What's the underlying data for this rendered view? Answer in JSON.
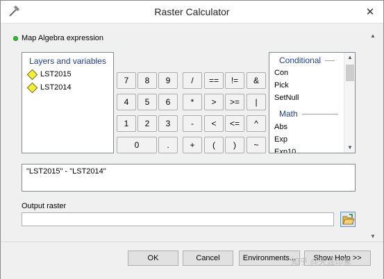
{
  "window": {
    "title": "Raster Calculator",
    "close_glyph": "✕"
  },
  "expression_section": {
    "heading": "Map Algebra expression"
  },
  "layers": {
    "header": "Layers and variables",
    "items": [
      "LST2015",
      "LST2014"
    ]
  },
  "keypad": {
    "rows": [
      [
        "7",
        "8",
        "9",
        "/",
        "==",
        "!=",
        "&"
      ],
      [
        "4",
        "5",
        "6",
        "*",
        ">",
        ">=",
        "|"
      ],
      [
        "1",
        "2",
        "3",
        "-",
        "<",
        "<=",
        "^"
      ],
      [
        "0",
        ".",
        "+",
        "(",
        ")",
        "~"
      ]
    ]
  },
  "functions": {
    "groups": [
      {
        "header": "Conditional",
        "items": [
          "Con",
          "Pick",
          "SetNull"
        ]
      },
      {
        "header": "Math",
        "items": [
          "Abs",
          "Exp",
          "Exp10"
        ]
      }
    ]
  },
  "expression": {
    "value": "\"LST2015\" - \"LST2014\""
  },
  "output": {
    "label": "Output raster",
    "value": ""
  },
  "footer": {
    "ok": "OK",
    "cancel": "Cancel",
    "environments": "Environments...",
    "show_help": "Show Help >>"
  },
  "watermark": "知乎 @天涯印象"
}
